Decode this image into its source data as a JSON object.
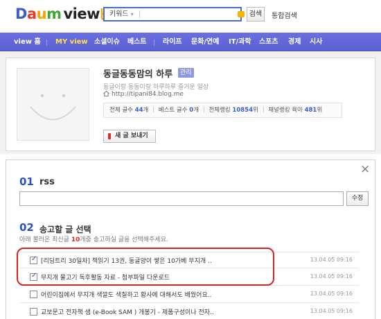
{
  "header": {
    "logo": {
      "d": "D",
      "a": "a",
      "u": "u",
      "m": "m",
      "view": "view"
    },
    "search": {
      "keyword_label": "키워드",
      "placeholder": "",
      "value": ""
    },
    "search_button": "검색",
    "unified_search": "통합검색"
  },
  "nav": {
    "items": [
      {
        "label": "view 홈",
        "active": false
      },
      {
        "label": "MY view",
        "active": true
      },
      {
        "label": "소셜이슈",
        "active": false
      },
      {
        "label": "베스트",
        "active": false
      },
      {
        "label": "라이프",
        "active": false
      },
      {
        "label": "문화/연예",
        "active": false
      },
      {
        "label": "IT/과학",
        "active": false
      },
      {
        "label": "스포츠",
        "active": false
      },
      {
        "label": "경제",
        "active": false
      },
      {
        "label": "시사",
        "active": false
      }
    ]
  },
  "profile": {
    "blog_title": "동글동동맘의 하루",
    "admin_badge": "관리",
    "description": "동글이랑 동동이랑 하루하루 즐거운 일상",
    "url": "http://tipani84.blog.me",
    "stats": {
      "total_label": "전체 글수",
      "total_value": "44",
      "total_unit": "개",
      "best_label": "베스트 글수",
      "best_value": "0",
      "best_unit": "개",
      "rank_label": "전체랭킹",
      "rank_value": "10854",
      "rank_unit": "위",
      "channel_label": "채널랭킹",
      "channel_name": "육아",
      "channel_value": "481",
      "channel_unit": "위"
    },
    "write_button": "새 글 보내기"
  },
  "panel": {
    "close_symbol": "×",
    "step1": {
      "num": "01",
      "title": "rss"
    },
    "rss_input": {
      "value": "",
      "placeholder": ""
    },
    "edit_button": "수정",
    "step2": {
      "num": "02",
      "title": "송고할 글 선택"
    },
    "hint": {
      "before": "아래 불러온 최신글 ",
      "count": "10",
      "after": "개중 송고하실 글을 선택해주세요."
    },
    "posts": [
      {
        "title": "[리딩트리 30일차] 책읽기 13권, 동글양이 쌓은 10가베 무지개 ..",
        "date": "13.04.05 09:16",
        "checked": true
      },
      {
        "title": "무지개 물고기 독후활동 자료 - 첨부파일 다운로드",
        "date": "13.04.05 09:16",
        "checked": true
      },
      {
        "title": "어린이집에서 무지개 색깔도 색칠하고 황사에 대해서도 배웠어요..",
        "date": "13.04.05 09:16",
        "checked": false
      },
      {
        "title": "교보문고 전자책 샘 (e-Book SAM ) 개봉기 - 제품구성이나 전자..",
        "date": "13.04.05 09:16",
        "checked": false
      }
    ]
  },
  "colors": {
    "nav_bg": "#5a5fd3",
    "nav_active": "#ffe04b",
    "accent_blue": "#2a52be",
    "highlight_red": "#e02020"
  }
}
